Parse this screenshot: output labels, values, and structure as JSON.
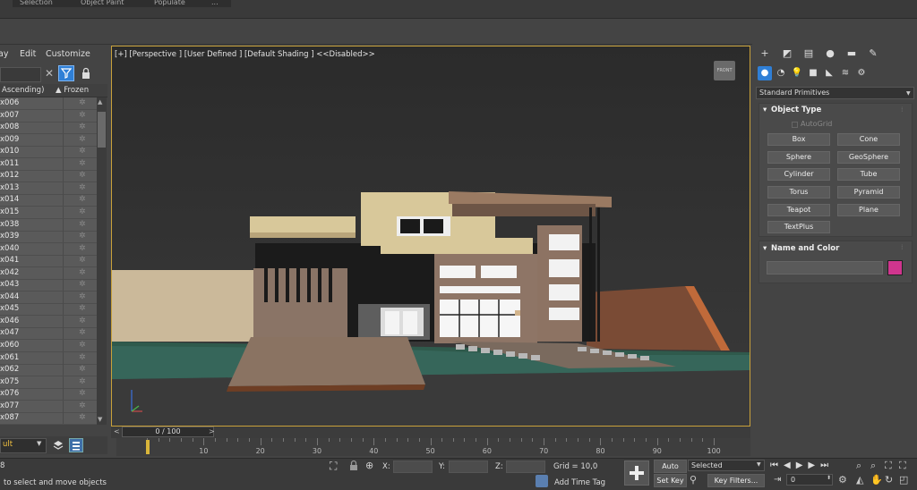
{
  "top_tabs": [
    "Selection",
    "Object Paint",
    "Populate",
    "..."
  ],
  "explorer": {
    "menu": [
      "ay",
      "Edit",
      "Customize"
    ],
    "col_name_header": "Ascending)",
    "col_frozen_header": "▲ Frozen",
    "rows": [
      "x006",
      "x007",
      "x008",
      "x009",
      "x010",
      "x011",
      "x012",
      "x013",
      "x014",
      "x015",
      "x038",
      "x039",
      "x040",
      "x041",
      "x042",
      "x043",
      "x044",
      "x045",
      "x046",
      "x047",
      "x060",
      "x061",
      "x062",
      "x075",
      "x076",
      "x077",
      "x087"
    ],
    "layer_value": "ult"
  },
  "viewport": {
    "label": "[+] [Perspective ] [User Defined ] [Default Shading ]  <<Disabled>>"
  },
  "timeline": {
    "slider_text": "0 / 100",
    "ticks": [
      "0",
      "10",
      "20",
      "30",
      "40",
      "50",
      "60",
      "70",
      "80",
      "90",
      "100"
    ]
  },
  "status": {
    "prompt": "to select and move objects",
    "x_label": "X:",
    "y_label": "Y:",
    "z_label": "Z:",
    "grid_text": "Grid = 10,0",
    "add_time_tag": "Add Time Tag",
    "auto_key": "Auto Key",
    "set_key": "Set Key",
    "selected_value": "Selected",
    "key_filters": "Key Filters...",
    "frame_value": "0",
    "left_mark": "8"
  },
  "command_panel": {
    "category": "Standard Primitives",
    "object_type_title": "Object Type",
    "autogrid": "AutoGrid",
    "buttons": [
      "Box",
      "Cone",
      "Sphere",
      "GeoSphere",
      "Cylinder",
      "Tube",
      "Torus",
      "Pyramid",
      "Teapot",
      "Plane",
      "TextPlus"
    ],
    "name_color_title": "Name and Color",
    "object_color": "#d0358e"
  },
  "colors": {
    "viewport_border": "#c9a13a",
    "active_filter": "#2f7fd6"
  }
}
